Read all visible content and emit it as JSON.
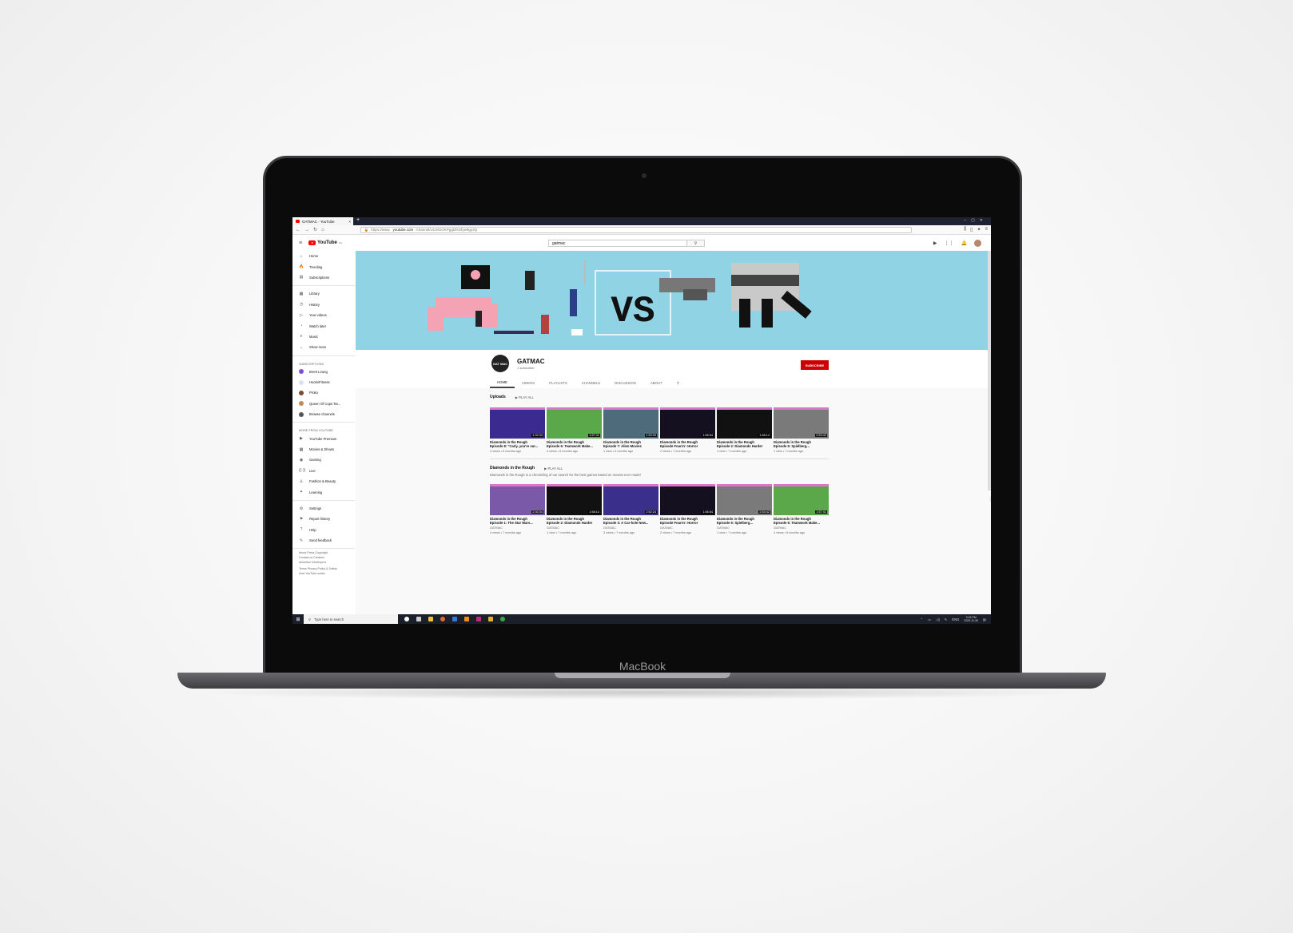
{
  "laptop": {
    "brand": "MacBook"
  },
  "browser": {
    "tab_title": "GATMAC - YouTube",
    "tab_close": "×",
    "new_tab": "+",
    "url_prefix": "https://www.",
    "url_domain": "youtube.com",
    "url_path": "/channel/UCMOOKPggDfsGfyw9gy3Q",
    "nav": {
      "back": "←",
      "forward": "→",
      "reload": "↻",
      "home": "⌂"
    }
  },
  "youtube": {
    "logo_text": "YouTube",
    "logo_country": "CA",
    "search_value": "gatmac",
    "sidebar": {
      "main": [
        {
          "icon": "⌂",
          "label": "Home"
        },
        {
          "icon": "🔥",
          "label": "Trending"
        },
        {
          "icon": "▤",
          "label": "Subscriptions"
        }
      ],
      "library": [
        {
          "icon": "▦",
          "label": "Library"
        },
        {
          "icon": "◷",
          "label": "History"
        },
        {
          "icon": "▷",
          "label": "Your videos"
        },
        {
          "icon": "◔",
          "label": "Watch later"
        },
        {
          "icon": "≡",
          "label": "Music"
        },
        {
          "icon": "⌄",
          "label": "Show more"
        }
      ],
      "subscriptions_heading": "SUBSCRIPTIONS",
      "subscriptions": [
        {
          "label": "Brent Leung",
          "color": "#7e4fd6"
        },
        {
          "label": "HoomiFitness",
          "color": "#d9e4ef"
        },
        {
          "label": "Proko",
          "color": "#7a4a32"
        },
        {
          "label": "Queen Of Cups Tar...",
          "color": "#c08a55"
        },
        {
          "label": "Browse channels",
          "color": "#555555"
        }
      ],
      "more_heading": "MORE FROM YOUTUBE",
      "more": [
        {
          "icon": "▶",
          "label": "YouTube Premium"
        },
        {
          "icon": "▦",
          "label": "Movies & Shows"
        },
        {
          "icon": "◉",
          "label": "Gaming"
        },
        {
          "icon": "((·))",
          "label": "Live"
        },
        {
          "icon": "♙",
          "label": "Fashion & Beauty"
        },
        {
          "icon": "✦",
          "label": "Learning"
        }
      ],
      "settings": [
        {
          "icon": "⚙",
          "label": "Settings"
        },
        {
          "icon": "⚑",
          "label": "Report history"
        },
        {
          "icon": "?",
          "label": "Help"
        },
        {
          "icon": "✎",
          "label": "Send feedback"
        }
      ],
      "footer1": "About  Press  Copyright",
      "footer2": "Contact us  Creators",
      "footer3": "Advertise  Developers",
      "footer4": "Terms  Privacy  Policy & Safety",
      "footer5": "How YouTube works"
    },
    "channel": {
      "banner_text": "VS",
      "name": "GATMAC",
      "logo_text": "GAT MAC",
      "subscribers": "1 subscriber",
      "subscribe_label": "SUBSCRIBE",
      "tabs": [
        "HOME",
        "VIDEOS",
        "PLAYLISTS",
        "CHANNELS",
        "DISCUSSION",
        "ABOUT"
      ]
    },
    "uploads": {
      "title": "Uploads",
      "play_all": "PLAY ALL",
      "videos": [
        {
          "title1": "Diamonds in the Rough",
          "title2": "Episode 8: \"Carly, you're sur...",
          "meta": "4 views • 6 months ago",
          "duration": "1:32:33",
          "bg": "#3b2a8f"
        },
        {
          "title1": "Diamonds in the Rough",
          "title2": "Episode 6: Teamwork Make...",
          "meta": "4 views • 6 months ago",
          "duration": "1:57:41",
          "bg": "#5ba84a"
        },
        {
          "title1": "Diamonds in the Rough",
          "title2": "Episode 7: Alien Movies",
          "meta": "1 view • 6 months ago",
          "duration": "1:59:09",
          "bg": "#4d6b7a"
        },
        {
          "title1": "Diamonds in the Rough",
          "title2": "Episode Fourrrr: Horror",
          "meta": "2 views • 7 months ago",
          "duration": "1:55:54",
          "bg": "#151020"
        },
        {
          "title1": "Diamonds in the Rough",
          "title2": "Episode 2: Diamonds Harder",
          "meta": "1 view • 7 months ago",
          "duration": "1:58:14",
          "bg": "#111111"
        },
        {
          "title1": "Diamonds in the Rough",
          "title2": "Episode 5: Spielberg...",
          "meta": "1 view • 7 months ago",
          "duration": "2:53:42",
          "bg": "#7a7a7a"
        }
      ]
    },
    "playlist": {
      "title": "Diamonds in the Rough",
      "play_all": "PLAY ALL",
      "description": "Diamonds in the Rough is a chronicling of our search for the best games based on movies ever made!",
      "videos": [
        {
          "title1": "Diamonds in the Rough",
          "title2": "Episode 1: The Star Wars...",
          "channel": "GATMAC",
          "meta": "4 views • 7 months ago",
          "duration": "2:30:34",
          "bg": "#7a5aa8"
        },
        {
          "title1": "Diamonds in the Rough",
          "title2": "Episode 2: Diamonds Harder",
          "channel": "GATMAC",
          "meta": "1 view • 7 months ago",
          "duration": "1:58:14",
          "bg": "#111111"
        },
        {
          "title1": "Diamonds in the Rough",
          "title2": "Episode 3: A Car-hole New...",
          "channel": "GATMAC",
          "meta": "3 views • 7 months ago",
          "duration": "2:52:24",
          "bg": "#3a2f8a"
        },
        {
          "title1": "Diamonds in the Rough",
          "title2": "Episode Fourrrr: Horror",
          "channel": "GATMAC",
          "meta": "2 views • 7 months ago",
          "duration": "1:55:54",
          "bg": "#151020"
        },
        {
          "title1": "Diamonds in the Rough",
          "title2": "Episode 5: Spielberg...",
          "channel": "GATMAC",
          "meta": "1 view • 7 months ago",
          "duration": "2:53:42",
          "bg": "#7a7a7a"
        },
        {
          "title1": "Diamonds in the Rough",
          "title2": "Episode 6: Teamwork Make...",
          "channel": "GATMAC",
          "meta": "4 views • 6 months ago",
          "duration": "1:57:41",
          "bg": "#5ba84a"
        }
      ]
    }
  },
  "taskbar": {
    "search_placeholder": "Type here to search",
    "lang": "ENG",
    "time": "3:15 PM",
    "date": "2020-11-30"
  }
}
